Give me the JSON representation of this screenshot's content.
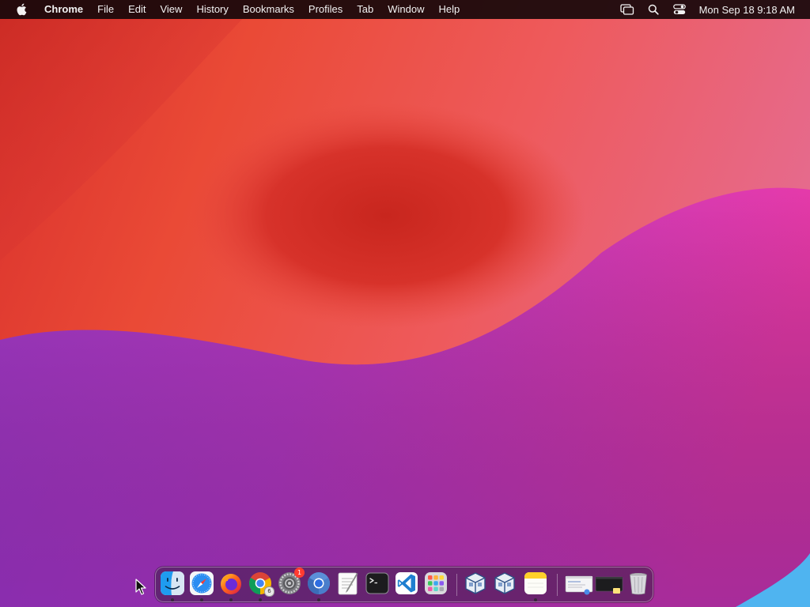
{
  "menubar": {
    "apple_icon": "apple-logo-icon",
    "app_name": "Chrome",
    "items": [
      "File",
      "Edit",
      "View",
      "History",
      "Bookmarks",
      "Profiles",
      "Tab",
      "Window",
      "Help"
    ],
    "status_icons": [
      "screen-mirroring-icon",
      "search-icon",
      "control-center-icon"
    ],
    "clock": "Mon Sep 18  9:18 AM"
  },
  "dock": {
    "apps": [
      {
        "name": "Finder",
        "icon": "finder-icon",
        "running": true
      },
      {
        "name": "Safari",
        "icon": "safari-icon",
        "running": true
      },
      {
        "name": "Firefox",
        "icon": "firefox-icon",
        "running": true
      },
      {
        "name": "Google Chrome",
        "icon": "chrome-icon",
        "running": true,
        "count": "6"
      },
      {
        "name": "System Settings",
        "icon": "settings-icon",
        "running": false,
        "badge": "1"
      },
      {
        "name": "Chromium",
        "icon": "chromium-icon",
        "running": true
      },
      {
        "name": "TextEdit",
        "icon": "textedit-icon",
        "running": false
      },
      {
        "name": "Terminal",
        "icon": "terminal-icon",
        "running": false
      },
      {
        "name": "Visual Studio Code",
        "icon": "vscode-icon",
        "running": false
      },
      {
        "name": "Launchpad",
        "icon": "launchpad-icon",
        "running": false
      },
      {
        "name": "VirtualBox",
        "icon": "virtualbox-icon",
        "running": false
      },
      {
        "name": "VirtualBox VM",
        "icon": "virtualbox-vm-icon",
        "running": false
      },
      {
        "name": "Notes",
        "icon": "notes-icon",
        "running": true
      }
    ],
    "recents": [
      {
        "name": "Recent document",
        "icon": "document-thumbnail-icon"
      },
      {
        "name": "Recent window",
        "icon": "window-thumbnail-icon"
      }
    ],
    "trash": {
      "name": "Trash",
      "icon": "trash-icon"
    }
  },
  "colors": {
    "menubar_bg": "#16080a",
    "wallpaper_red": "#d8302a",
    "wallpaper_pink": "#e83aa8",
    "wallpaper_purple": "#9a35c8",
    "badge_red": "#ff3b30"
  }
}
